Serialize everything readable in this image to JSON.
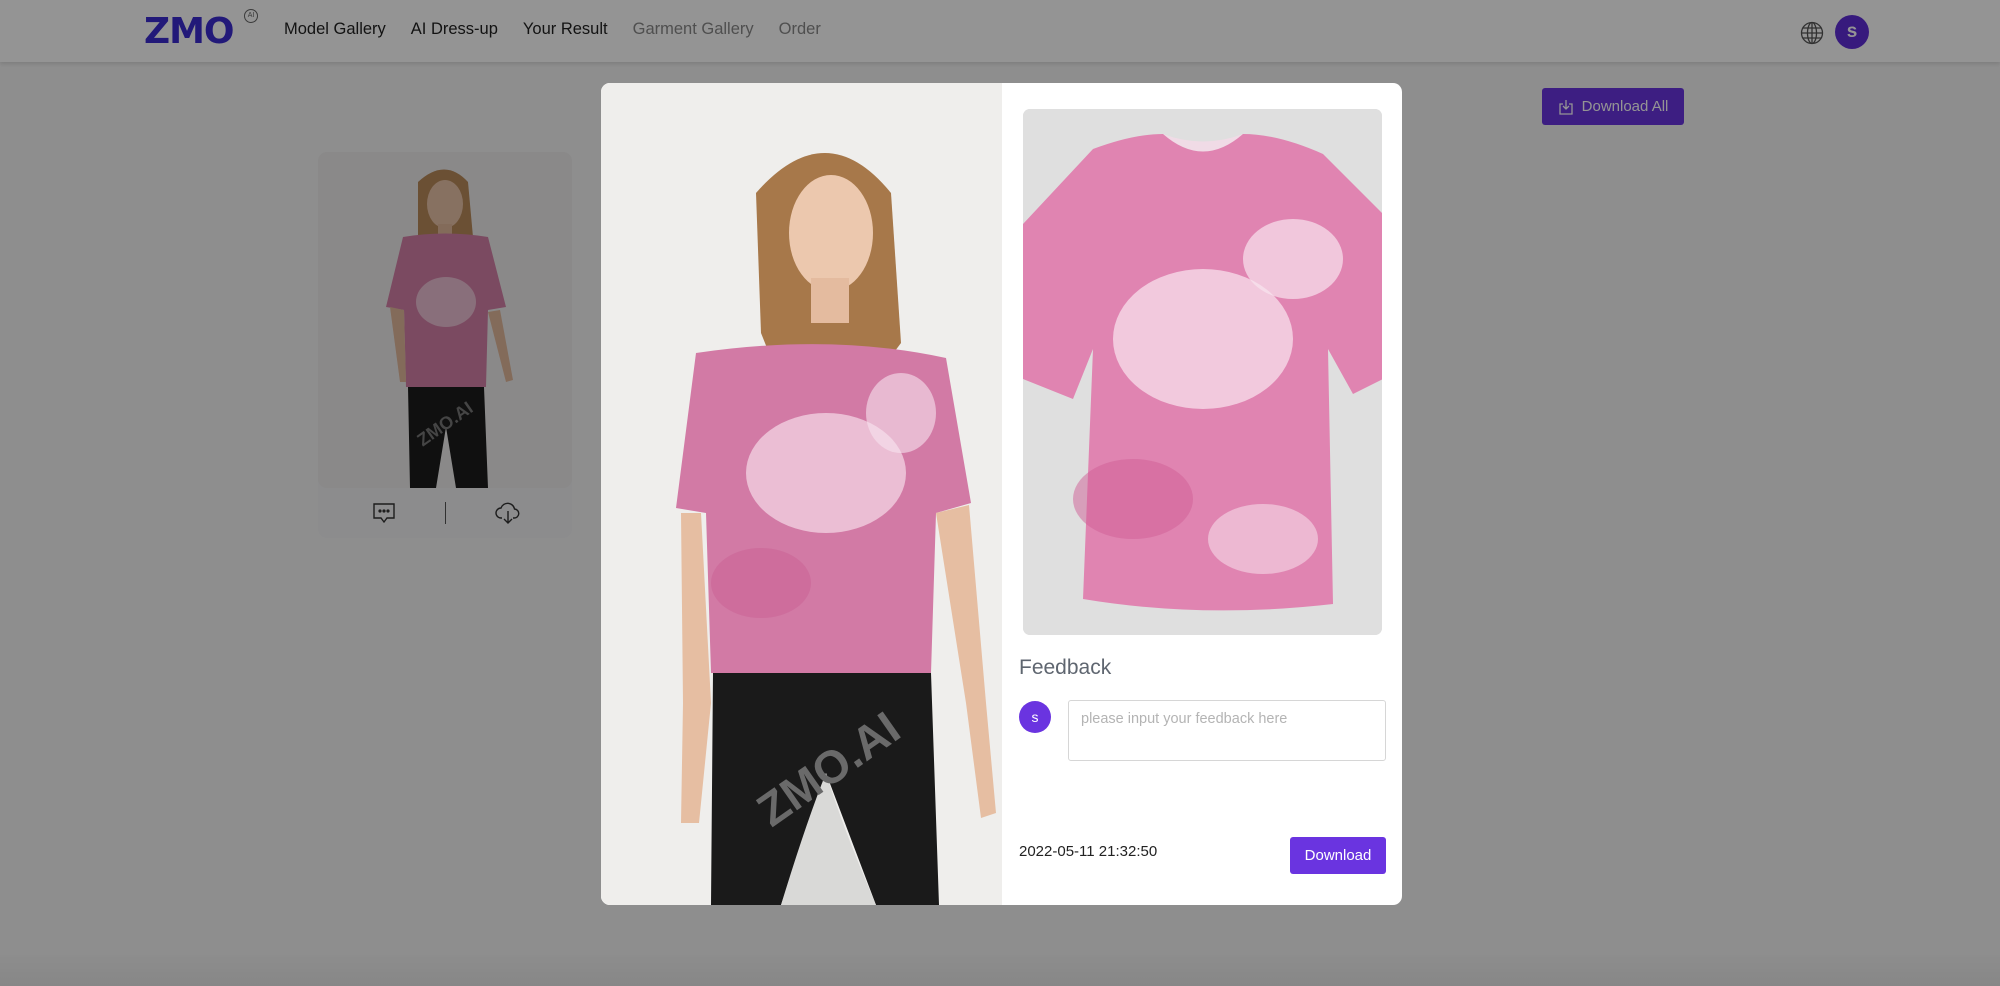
{
  "header": {
    "logo_text": "ZMO",
    "logo_badge": "AI",
    "nav": [
      {
        "label": "Model Gallery",
        "active": true
      },
      {
        "label": "AI Dress-up",
        "active": true
      },
      {
        "label": "Your Result",
        "active": true
      },
      {
        "label": "Garment Gallery",
        "active": false
      },
      {
        "label": "Order",
        "active": false
      }
    ],
    "language_icon": "globe-icon",
    "user_initial": "s"
  },
  "page": {
    "download_all_label": "Download All",
    "download_all_icon": "download-tray-icon",
    "result_card": {
      "image_alt": "Model wearing pink tie-dye t-shirt",
      "watermark": "ZMO.AI",
      "actions": [
        {
          "icon": "comment-icon",
          "label": "Feedback"
        },
        {
          "icon": "cloud-download-icon",
          "label": "Download"
        }
      ]
    }
  },
  "modal": {
    "model_image_alt": "Model wearing pink tie-dye t-shirt with black pants",
    "watermark": "ZMO.AI",
    "garment_image_alt": "Pink tie-dye t-shirt",
    "feedback": {
      "title": "Feedback",
      "user_initial": "s",
      "placeholder": "please input your feedback here",
      "value": ""
    },
    "timestamp": "2022-05-11 21:32:50",
    "download_label": "Download"
  },
  "colors": {
    "brand": "#6a34e0",
    "logo": "#3b2bd1",
    "overlay": "rgba(0,0,0,0.42)"
  }
}
